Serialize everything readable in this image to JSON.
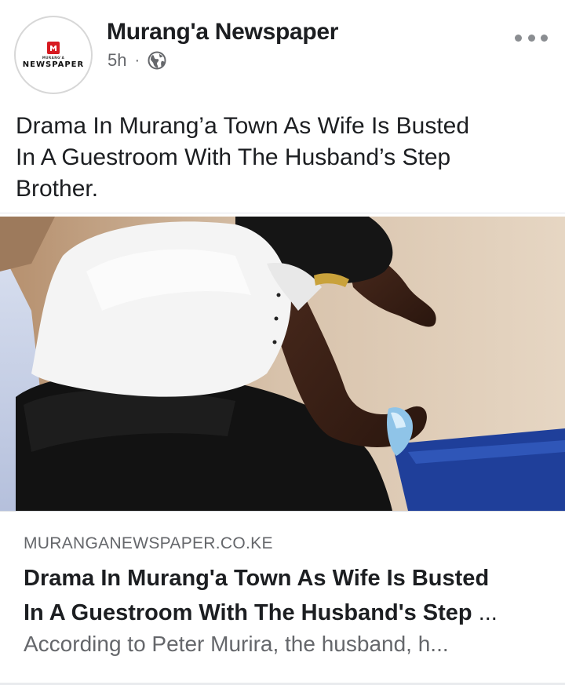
{
  "post": {
    "page_name": "Murang'a Newspaper",
    "timestamp": "5h",
    "separator": "·",
    "audience_icon": "globe-icon",
    "more_icon": "more-options-icon",
    "text_line_1": "Drama In Murang’a Town As Wife Is Busted",
    "text_line_2": "In A Guestroom With The Husband’s Step",
    "text_line_3": "Brother."
  },
  "avatar": {
    "top_text": "MURANG'A",
    "name_text": "NEWSPAPER"
  },
  "photo": {
    "icon": "photo-image"
  },
  "link_preview": {
    "domain": "MURANGANEWSPAPER.CO.KE",
    "title_line_1": "Drama In Murang'a Town As Wife Is Busted",
    "title_line_2": "In A Guestroom With The Husband's Step",
    "title_ellipsis": "...",
    "description": "According to Peter Murira, the husband, h..."
  },
  "colors": {
    "text_primary": "#1c1e21",
    "text_secondary": "#65676b",
    "logo_red": "#d71920"
  }
}
